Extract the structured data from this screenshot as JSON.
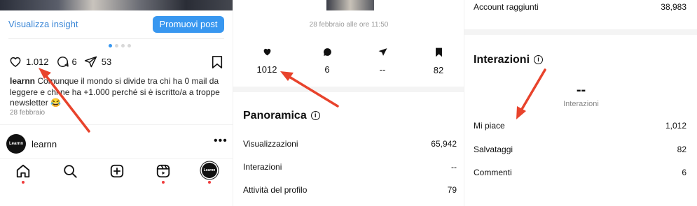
{
  "post": {
    "insight_link": "Visualizza insight",
    "promote_button": "Promuovi post",
    "likes": "1.012",
    "comments": "6",
    "shares": "53",
    "caption_user": "learnn",
    "caption_text": " Comunque il mondo si divide tra chi ha 0 mail da leggere e chi ne ha +1.000 perché si è iscritto/a a troppe newsletter 😂",
    "date": "28 febbraio",
    "account_name": "learnn",
    "avatar_text": "Learnn",
    "more": "•••",
    "carousel_dots": 4,
    "active_dot": 0
  },
  "insights": {
    "date": "28 febbraio alle ore 11:50",
    "stats": [
      {
        "icon": "heart-icon",
        "value": "1012"
      },
      {
        "icon": "comment-icon",
        "value": "6"
      },
      {
        "icon": "share-icon",
        "value": "--"
      },
      {
        "icon": "bookmark-icon",
        "value": "82"
      }
    ],
    "overview_title": "Panoramica",
    "overview_rows": [
      {
        "label": "Visualizzazioni",
        "value": "65,942"
      },
      {
        "label": "Interazioni",
        "value": "--"
      },
      {
        "label": "Attività del profilo",
        "value": "79"
      }
    ]
  },
  "interactions": {
    "reach_label": "Account raggiunti",
    "reach_value": "38,983",
    "title": "Interazioni",
    "total": "--",
    "total_label": "Interazioni",
    "rows": [
      {
        "label": "Mi piace",
        "value": "1,012"
      },
      {
        "label": "Salvataggi",
        "value": "82"
      },
      {
        "label": "Commenti",
        "value": "6"
      }
    ]
  },
  "colors": {
    "accent": "#3897f0",
    "arrow": "#e8432c",
    "notification_dot": "#ef3b3b"
  }
}
